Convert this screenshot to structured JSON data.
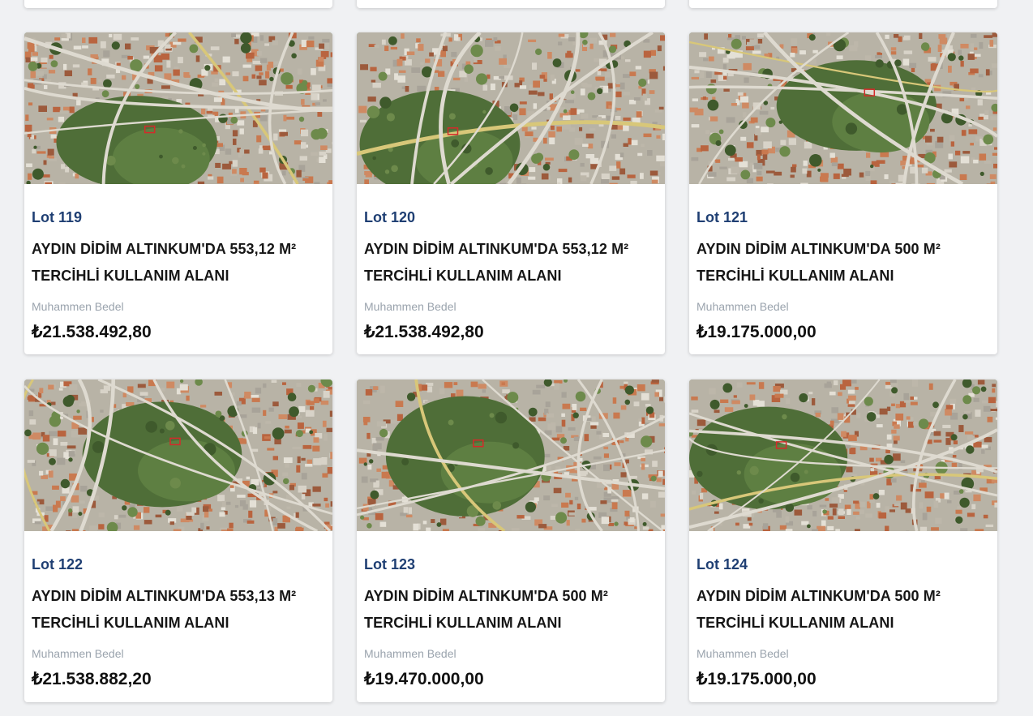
{
  "lots": [
    {
      "lot": "Lot 119",
      "title": "AYDIN DİDİM ALTINKUM'DA 553,12 M² TERCİHLİ KULLANIM ALANI",
      "price_label": "Muhammen Bedel",
      "price": "₺21.538.492,80"
    },
    {
      "lot": "Lot 120",
      "title": "AYDIN DİDİM ALTINKUM'DA 553,12 M² TERCİHLİ KULLANIM ALANI",
      "price_label": "Muhammen Bedel",
      "price": "₺21.538.492,80"
    },
    {
      "lot": "Lot 121",
      "title": "AYDIN DİDİM ALTINKUM'DA 500 M² TERCİHLİ KULLANIM ALANI",
      "price_label": "Muhammen Bedel",
      "price": "₺19.175.000,00"
    },
    {
      "lot": "Lot 122",
      "title": "AYDIN DİDİM ALTINKUM'DA 553,13 M² TERCİHLİ KULLANIM ALANI",
      "price_label": "Muhammen Bedel",
      "price": "₺21.538.882,20"
    },
    {
      "lot": "Lot 123",
      "title": "AYDIN DİDİM ALTINKUM'DA 500 M² TERCİHLİ KULLANIM ALANI",
      "price_label": "Muhammen Bedel",
      "price": "₺19.470.000,00"
    },
    {
      "lot": "Lot 124",
      "title": "AYDIN DİDİM ALTINKUM'DA 500 M² TERCİHLİ KULLANIM ALANI",
      "price_label": "Muhammen Bedel",
      "price": "₺19.175.000,00"
    }
  ],
  "colors": {
    "lot_number": "#1f3f73",
    "title": "#161616",
    "price_label": "#9aa3ad",
    "price": "#111111",
    "page_background": "#f0f1f3"
  },
  "thumbnail_icon": "satellite-map-image"
}
